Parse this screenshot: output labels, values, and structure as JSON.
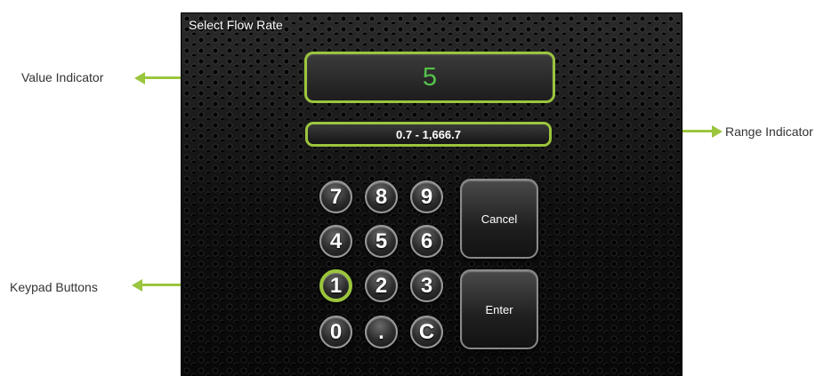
{
  "screen": {
    "title": "Select Flow Rate",
    "value": "5",
    "range": "0.7 - 1,666.7"
  },
  "keypad": {
    "keys": [
      "7",
      "8",
      "9",
      "4",
      "5",
      "6",
      "1",
      "2",
      "3",
      "0",
      ".",
      "C"
    ],
    "selected_key": "1",
    "cancel_label": "Cancel",
    "enter_label": "Enter"
  },
  "callouts": {
    "value_indicator": "Value Indicator",
    "range_indicator": "Range Indicator",
    "keypad_buttons": "Keypad Buttons"
  },
  "colors": {
    "accent": "#9bc53d",
    "value_text": "#54c34a"
  }
}
